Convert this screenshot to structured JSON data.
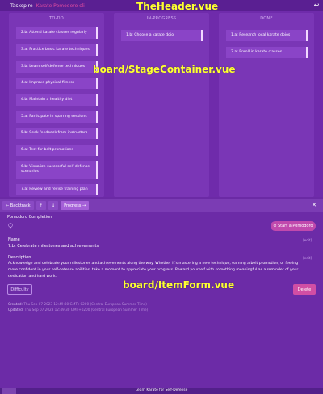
{
  "header": {
    "app_name": "Taskspire",
    "project_name": "Karate Pomodoro cli",
    "back_icon": "return-icon",
    "overlay_label": "TheHeader.vue"
  },
  "board": {
    "overlay_label": "board/StageContainer.vue",
    "columns": [
      {
        "title": "TO-DO",
        "cards": [
          "2.b: Attend karate classes regularly",
          "3.a: Practice basic karate techniques",
          "3.b: Learn self-defense techniques",
          "4.a: Improve physical fitness",
          "4.b: Maintain a healthy diet",
          "5.a: Participate in sparring sessions",
          "5.b: Seek feedback from instructors",
          "6.a: Test for belt promotions",
          "6.b: Visualize successful self-defense scenarios",
          "7.a: Review and revise training plan"
        ]
      },
      {
        "title": "IN-PROGRESS",
        "cards": [
          "1.b: Choose a karate dojo"
        ]
      },
      {
        "title": "DONE",
        "cards": [
          "1.a: Research local karate dojos",
          "2.a: Enroll in karate classes"
        ]
      }
    ]
  },
  "item_form": {
    "overlay_label": "board/ItemForm.vue",
    "toolbar": {
      "backtrack": "← Backtrack",
      "move_up": "↑",
      "move_down": "↓",
      "progress": "Progress →",
      "close_icon": "close-icon"
    },
    "pomodoro_label": "Pomodoro Completion",
    "start_pomodoro": "⏱ Start a Pomodoro",
    "name_label": "Name",
    "name_edit": "[edit]",
    "name_value": "7.b: Celebrate milestones and achievements",
    "description_label": "Description",
    "description_edit": "[edit]",
    "description_value": "Acknowledge and celebrate your milestones and achievements along the way. Whether it's mastering a new technique, earning a belt promotion, or feeling more confident in your self-defense abilities, take a moment to appreciate your progress. Reward yourself with something meaningful as a reminder of your dedication and hard work.",
    "difficulty_button": "Difficulty",
    "delete_button": "Delete",
    "created_label": "Created:",
    "created_value": "Thu Sep 07 2023 12:49:30 GMT+0200 (Central European Summer Time)",
    "updated_label": "Updated:",
    "updated_value": "Thu Sep 07 2023 12:49:30 GMT+0200 (Central European Summer Time)"
  },
  "footer": {
    "title": "Learn Karate for Self-Defense"
  },
  "colors": {
    "background": "#6b2aa5",
    "card": "#8a44c7",
    "accent_pink": "#c149ad",
    "overlay_yellow": "#ffff33"
  }
}
